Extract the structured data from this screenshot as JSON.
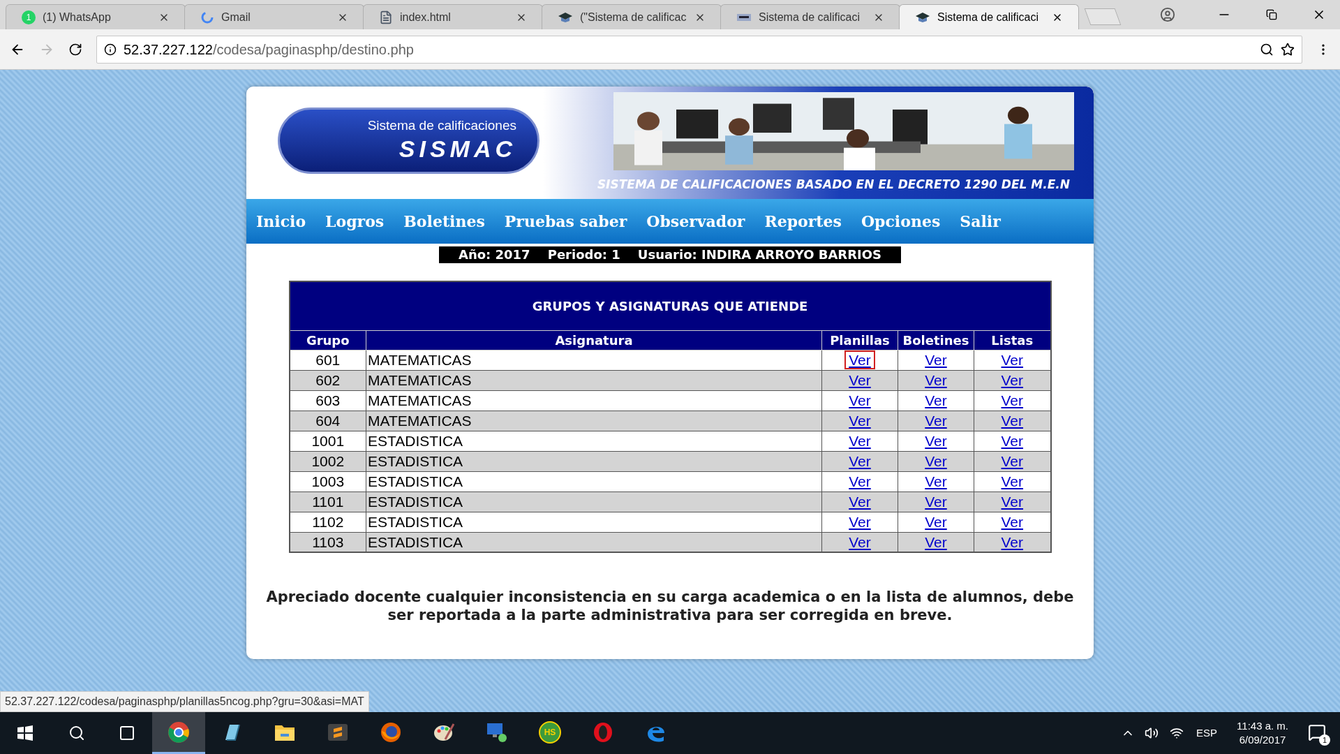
{
  "browser": {
    "tabs": [
      {
        "title": "(1) WhatsApp",
        "badge": "1",
        "kind": "whatsapp",
        "selected": false
      },
      {
        "title": "Gmail",
        "kind": "google",
        "selected": false
      },
      {
        "title": "index.html",
        "kind": "file",
        "selected": false
      },
      {
        "title": "(\"Sistema de calificac",
        "kind": "cap",
        "selected": false
      },
      {
        "title": "Sistema de calificaci",
        "kind": "flag",
        "selected": false
      },
      {
        "title": "Sistema de calificaci",
        "kind": "cap",
        "selected": true
      }
    ],
    "address": {
      "host": "52.37.227.122",
      "path": "/codesa/paginasphp/destino.php"
    }
  },
  "header": {
    "logo_small": "Sistema de calificaciones",
    "logo_big": "SISMAC",
    "caption": "SISTEMA DE CALIFICACIONES BASADO EN EL DECRETO 1290 DEL M.E.N"
  },
  "nav": [
    "Inicio",
    "Logros",
    "Boletines",
    "Pruebas saber",
    "Observador",
    "Reportes",
    "Opciones",
    "Salir"
  ],
  "info": "Año: 2017    Periodo: 1    Usuario: INDIRA ARROYO BARRIOS",
  "table": {
    "title": "GRUPOS Y ASIGNATURAS QUE ATIENDE",
    "columns": [
      "Grupo",
      "Asignatura",
      "Planillas",
      "Boletines",
      "Listas"
    ],
    "rows": [
      {
        "grupo": "601",
        "asignatura": "MATEMATICAS",
        "links": [
          {
            "text": "Ver",
            "focused": true
          },
          {
            "text": "Ver",
            "focused": false
          },
          {
            "text": "Ver",
            "focused": false
          }
        ]
      },
      {
        "grupo": "602",
        "asignatura": "MATEMATICAS",
        "links": [
          {
            "text": "Ver",
            "focused": false
          },
          {
            "text": "Ver",
            "focused": false
          },
          {
            "text": "Ver",
            "focused": false
          }
        ]
      },
      {
        "grupo": "603",
        "asignatura": "MATEMATICAS",
        "links": [
          {
            "text": "Ver",
            "focused": false
          },
          {
            "text": "Ver",
            "focused": false
          },
          {
            "text": "Ver",
            "focused": false
          }
        ]
      },
      {
        "grupo": "604",
        "asignatura": "MATEMATICAS",
        "links": [
          {
            "text": "Ver",
            "focused": false
          },
          {
            "text": "Ver",
            "focused": false
          },
          {
            "text": "Ver",
            "focused": false
          }
        ]
      },
      {
        "grupo": "1001",
        "asignatura": "ESTADISTICA",
        "links": [
          {
            "text": "Ver",
            "focused": false
          },
          {
            "text": "Ver",
            "focused": false
          },
          {
            "text": "Ver",
            "focused": false
          }
        ]
      },
      {
        "grupo": "1002",
        "asignatura": "ESTADISTICA",
        "links": [
          {
            "text": "Ver",
            "focused": false
          },
          {
            "text": "Ver",
            "focused": false
          },
          {
            "text": "Ver",
            "focused": false
          }
        ]
      },
      {
        "grupo": "1003",
        "asignatura": "ESTADISTICA",
        "links": [
          {
            "text": "Ver",
            "focused": false
          },
          {
            "text": "Ver",
            "focused": false
          },
          {
            "text": "Ver",
            "focused": false
          }
        ]
      },
      {
        "grupo": "1101",
        "asignatura": "ESTADISTICA",
        "links": [
          {
            "text": "Ver",
            "focused": false
          },
          {
            "text": "Ver",
            "focused": false
          },
          {
            "text": "Ver",
            "focused": false
          }
        ]
      },
      {
        "grupo": "1102",
        "asignatura": "ESTADISTICA",
        "links": [
          {
            "text": "Ver",
            "focused": false
          },
          {
            "text": "Ver",
            "focused": false
          },
          {
            "text": "Ver",
            "focused": false
          }
        ]
      },
      {
        "grupo": "1103",
        "asignatura": "ESTADISTICA",
        "links": [
          {
            "text": "Ver",
            "focused": false
          },
          {
            "text": "Ver",
            "focused": false
          },
          {
            "text": "Ver",
            "focused": false
          }
        ]
      }
    ]
  },
  "notice": "Apreciado docente cualquier inconsistencia en su carga academica o en la lista de alumnos, debe ser reportada a la parte administrativa para ser corregida en breve.",
  "status_url": "52.37.227.122/codesa/paginasphp/planillas5ncog.php?gru=30&asi=MAT",
  "taskbar": {
    "apps": [
      {
        "kind": "chrome",
        "active": true
      },
      {
        "kind": "notepad",
        "active": false
      },
      {
        "kind": "folder",
        "active": false
      },
      {
        "kind": "sublime",
        "active": false
      },
      {
        "kind": "firefox",
        "active": false
      },
      {
        "kind": "paint",
        "active": false
      },
      {
        "kind": "remote",
        "active": false
      },
      {
        "kind": "hs",
        "label": "HS",
        "active": false
      },
      {
        "kind": "opera",
        "active": false
      },
      {
        "kind": "edge",
        "active": false
      }
    ],
    "language": "ESP",
    "time": "11:43 a. m.",
    "date": "6/09/2017",
    "notifications": "1"
  }
}
